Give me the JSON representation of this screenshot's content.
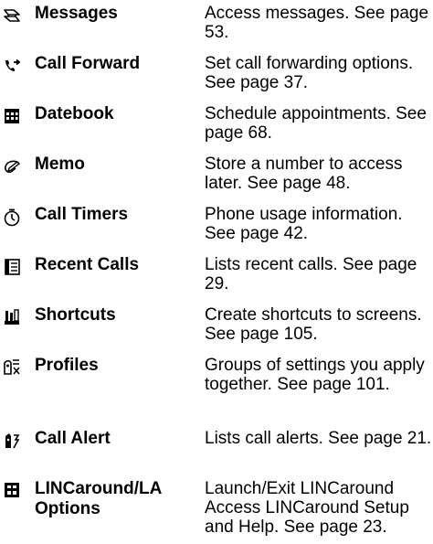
{
  "menu_items": [
    {
      "icon": "messages-icon",
      "name": "Messages",
      "description": "Access messages. See page 53."
    },
    {
      "icon": "call-forward-icon",
      "name": "Call Forward",
      "description": "Set call forwarding options. See page 37."
    },
    {
      "icon": "datebook-icon",
      "name": "Datebook",
      "description": "Schedule appointments. See page 68."
    },
    {
      "icon": "memo-icon",
      "name": "Memo",
      "description": "Store a number to access later. See page 48."
    },
    {
      "icon": "call-timers-icon",
      "name": "Call Timers",
      "description": "Phone usage information. See page 42."
    },
    {
      "icon": "recent-calls-icon",
      "name": "Recent Calls",
      "description": "Lists recent calls. See page 29."
    },
    {
      "icon": "shortcuts-icon",
      "name": "Shortcuts",
      "description": "Create shortcuts to screens. See page 105."
    },
    {
      "icon": "profiles-icon",
      "name": "Profiles",
      "description": "Groups of settings you apply together. See page 101."
    },
    {
      "icon": "call-alert-icon",
      "name": "Call Alert",
      "description": "Lists call alerts. See page 21."
    },
    {
      "icon": "lincaround-icon",
      "name": "LINCaround/LA Options",
      "description": "Launch/Exit LINCaround Access LINCaround Setup and Help. See page 23."
    }
  ]
}
